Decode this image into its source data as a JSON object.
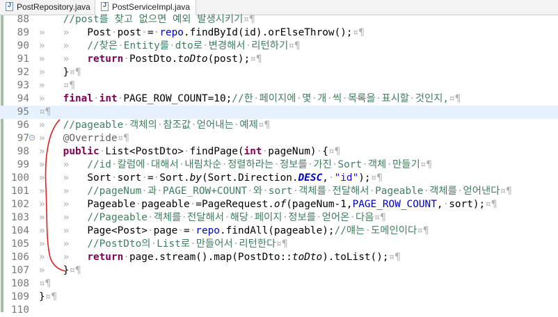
{
  "tabs": [
    {
      "label": "PostRepository.java",
      "active": false
    },
    {
      "label": "PostServiceImpl.java",
      "active": true
    }
  ],
  "lines": [
    {
      "num": "88",
      "text": "    //post를 찾고 없으면 예외 발생시키기¤¶"
    },
    {
      "num": "89",
      "text": "»   »   Post·post·=·repo.findById(id).orElseThrow();¤¶"
    },
    {
      "num": "90",
      "text": "»   »   //찾은·Entity를·dto로·변경해서·리턴하기¤¶"
    },
    {
      "num": "91",
      "text": "»   »   return·PostDto.toDto(post);¤¶"
    },
    {
      "num": "92",
      "text": "»   }¤¶"
    },
    {
      "num": "93",
      "text": "»   ¤¶"
    },
    {
      "num": "94",
      "text": "»   final·int·PAGE_ROW_COUNT=10;//한·페이지에·몇·개·씩·목록을·표시할·것인지,¤¶"
    },
    {
      "num": "95",
      "text": "¤¶"
    },
    {
      "num": "96",
      "text": "»   //pageable·객체의·참조값·얻어내는·예제¤¶"
    },
    {
      "num": "97",
      "text": "»   @Override¤¶"
    },
    {
      "num": "98",
      "text": "»   public·List<PostDto>·findPage(int·pageNum)·{¤¶"
    },
    {
      "num": "99",
      "text": "»   »   //id·칼럼에·대해서·내림차순·정렬하라는·정보를·가진·Sort·객체·만들기¤¶"
    },
    {
      "num": "100",
      "text": "»   »   Sort·sort·=·Sort.by(Sort.Direction.DESC,·\"id\");¤¶"
    },
    {
      "num": "101",
      "text": "»   »   //pageNum·과·PAGE_ROW+COUNT·와·sort·객체를·전달해서·Pageable·객체를·얻어낸다¤¶"
    },
    {
      "num": "102",
      "text": "»   »   Pageable·pageable·=PageRequest.of(pageNum-1,PAGE_ROW_COUNT,·sort);¤¶"
    },
    {
      "num": "103",
      "text": "»   »   //Pageable·객체를·전달해서·해당·페이지·정보를·얻어온·다음¤¶"
    },
    {
      "num": "104",
      "text": "»   »   Page<Post>·page·=·repo.findAll(pageable);//얘는·도메인이다¤¶"
    },
    {
      "num": "105",
      "text": "»   »   //PostDto의·List로·만들어서·리턴한다¤¶"
    },
    {
      "num": "106",
      "text": "»   »   return·page.stream().map(PostDto::toDto).toList();¤¶"
    },
    {
      "num": "107",
      "text": "»   }¤¶"
    },
    {
      "num": "108",
      "text": "¤¶"
    },
    {
      "num": "109",
      "text": "}¤¶"
    },
    {
      "num": "110",
      "text": ""
    }
  ],
  "current_line": "95",
  "colors": {
    "keyword": "#7f0055",
    "comment": "#3f7f5f",
    "field": "#0000c0",
    "string": "#2a00ff",
    "annotation": "#646464",
    "current_line_bg": "#e8f2fe",
    "change_bar": "#9fc0a3",
    "red_bracket": "#e02020"
  },
  "icons": {
    "tab_file": "java-file-icon",
    "fold": "fold-toggle-icon"
  }
}
